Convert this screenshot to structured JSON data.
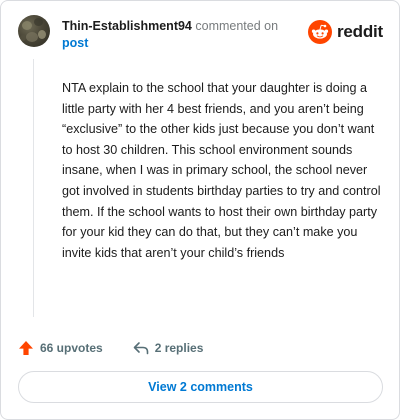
{
  "header": {
    "username": "Thin-Establishment94",
    "action": "commented on",
    "post_link": "post",
    "brand": "reddit",
    "brand_color": "#ff4500"
  },
  "comment": {
    "text": "NTA explain to the school that your daughter is doing a little party with her 4 best friends, and you aren’t being “exclusive” to the other kids just because you don’t want to host 30 children. This school environment sounds insane, when I was in primary school, the school never got involved in students birthday parties to try and control them. If the school wants to host their own birthday party for your kid they can do that, but they can’t make you invite kids that aren’t your child’s friends"
  },
  "actions": {
    "upvotes": "66 upvotes",
    "upvote_icon": "upvote-arrow-icon",
    "upvote_color": "#ff4500",
    "replies": "2 replies",
    "reply_icon": "reply-arrow-icon"
  },
  "footer": {
    "view_comments": "View 2 comments"
  }
}
